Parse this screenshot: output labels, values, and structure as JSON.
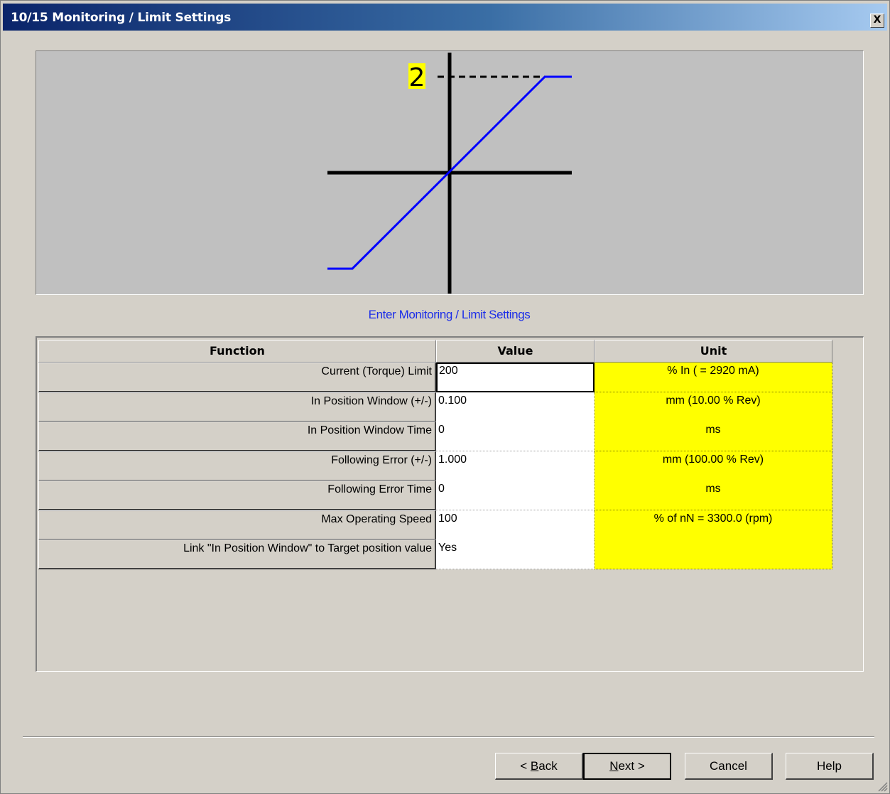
{
  "window": {
    "title": "10/15 Monitoring / Limit Settings",
    "close_glyph": "X"
  },
  "diagram": {
    "limit_label": "2",
    "curve_color": "#0000ff",
    "background_color": "#c0c0c0",
    "label_highlight_color": "#ffff00"
  },
  "subtitle": "Enter Monitoring / Limit Settings",
  "table": {
    "headers": {
      "function": "Function",
      "value": "Value",
      "unit": "Unit"
    },
    "rows": [
      {
        "function": "Current (Torque) Limit",
        "value": "200",
        "unit": "% In ( = 2920 mA)"
      },
      {
        "function": "In Position Window  (+/-)",
        "value": "0.100",
        "unit": "mm (10.00 % Rev)"
      },
      {
        "function": "In Position Window Time",
        "value": "0",
        "unit": "ms"
      },
      {
        "function": "Following Error  (+/-)",
        "value": "1.000",
        "unit": "mm (100.00 % Rev)"
      },
      {
        "function": "Following Error Time",
        "value": "0",
        "unit": "ms"
      },
      {
        "function": "Max Operating Speed",
        "value": "100",
        "unit": "% of nN = 3300.0 (rpm)"
      },
      {
        "function": "Link \"In Position Window\" to Target position value",
        "value": "Yes",
        "unit": ""
      }
    ],
    "unit_cell_color": "#ffff00"
  },
  "buttons": {
    "back": {
      "prefix": "< ",
      "mnemonic": "B",
      "rest": "ack"
    },
    "next": {
      "mnemonic": "N",
      "rest": "ext >"
    },
    "cancel": "Cancel",
    "help": "Help"
  },
  "theme": {
    "dialog_face": "#d4d0c8",
    "title_gradient_start": "#0a246a",
    "subtitle_color": "#1c2ee8"
  }
}
